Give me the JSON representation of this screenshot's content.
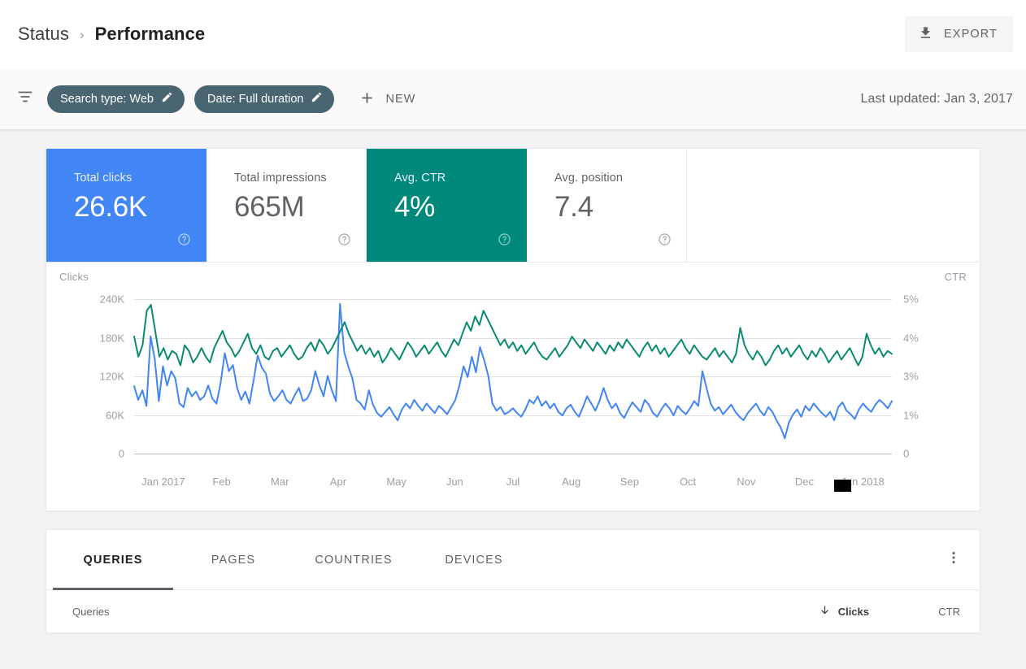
{
  "header": {
    "breadcrumb_root": "Status",
    "breadcrumb_separator": "›",
    "breadcrumb_current": "Performance",
    "export_label": "EXPORT",
    "export_icon": "download-icon"
  },
  "filter_bar": {
    "filter_icon": "tune-icon",
    "chips": [
      {
        "label": "Search type: Web",
        "icon": "pencil-icon"
      },
      {
        "label": "Date: Full duration",
        "icon": "pencil-icon"
      }
    ],
    "new_label": "NEW",
    "new_icon": "plus-icon",
    "last_updated": "Last updated: Jan 3, 2017"
  },
  "metrics": [
    {
      "label": "Total clicks",
      "value": "26.6K",
      "selected": true,
      "color": "#4285F4",
      "help_icon": "help-icon"
    },
    {
      "label": "Total impressions",
      "value": "665M",
      "selected": false,
      "color": "#FFFFFF",
      "help_icon": "help-icon"
    },
    {
      "label": "Avg. CTR",
      "value": "4%",
      "selected": true,
      "color": "#00897B",
      "help_icon": "help-icon"
    },
    {
      "label": "Avg. position",
      "value": "7.4",
      "selected": false,
      "color": "#FFFFFF",
      "help_icon": "help-icon"
    }
  ],
  "table": {
    "tabs": [
      {
        "label": "QUERIES",
        "active": true
      },
      {
        "label": "PAGES",
        "active": false
      },
      {
        "label": "COUNTRIES",
        "active": false
      },
      {
        "label": "DEVICES",
        "active": false
      }
    ],
    "more_icon": "more-vert-icon",
    "columns": {
      "first": "Queries",
      "clicks": "Clicks",
      "clicks_sort_icon": "sort-down-arrow-icon",
      "ctr": "CTR"
    }
  },
  "chart_data": {
    "type": "line",
    "title": "",
    "xlabel": "",
    "ylabel": "Clicks",
    "y2label": "CTR",
    "grid": true,
    "legend": "none",
    "left_axis": {
      "label": "Clicks",
      "ticks": [
        "240K",
        "180K",
        "120K",
        "60K",
        "0"
      ],
      "tick_values": [
        240000,
        180000,
        120000,
        60000,
        0
      ],
      "ylim": [
        0,
        240000
      ]
    },
    "right_axis": {
      "label": "CTR",
      "ticks": [
        "5%",
        "4%",
        "3%",
        "1%",
        "0"
      ],
      "tick_values": [
        5,
        4,
        3,
        1,
        0
      ],
      "ylim": [
        0,
        5
      ]
    },
    "x_ticks": [
      "Jan 2017",
      "Feb",
      "Mar",
      "Apr",
      "May",
      "Jun",
      "Jul",
      "Aug",
      "Sep",
      "Oct",
      "Nov",
      "Dec",
      "Jan 2018"
    ],
    "cursor_marker": {
      "near_tick": "Dec",
      "shape": "black-rectangle"
    },
    "series": [
      {
        "name": "Clicks",
        "color": "#4285F4",
        "axis": "left",
        "unit": "clicks",
        "values": [
          95000,
          72000,
          88000,
          62000,
          178000,
          140000,
          70000,
          128000,
          96000,
          120000,
          108000,
          66000,
          60000,
          92000,
          78000,
          86000,
          72000,
          78000,
          96000,
          74000,
          66000,
          100000,
          150000,
          120000,
          130000,
          92000,
          72000,
          86000,
          66000,
          104000,
          146000,
          126000,
          116000,
          82000,
          70000,
          78000,
          88000,
          72000,
          66000,
          80000,
          92000,
          70000,
          74000,
          88000,
          120000,
          96000,
          78000,
          112000,
          88000,
          70000,
          232000,
          152000,
          128000,
          108000,
          72000,
          66000,
          56000,
          88000,
          64000,
          50000,
          44000,
          52000,
          60000,
          48000,
          38000,
          56000,
          66000,
          58000,
          72000,
          62000,
          54000,
          66000,
          58000,
          50000,
          62000,
          56000,
          48000,
          60000,
          72000,
          96000,
          128000,
          110000,
          144000,
          118000,
          160000,
          138000,
          112000,
          66000,
          54000,
          60000,
          48000,
          52000,
          58000,
          50000,
          44000,
          56000,
          72000,
          66000,
          78000,
          62000,
          70000,
          58000,
          66000,
          52000,
          46000,
          58000,
          64000,
          52000,
          44000,
          60000,
          78000,
          66000,
          54000,
          70000,
          92000,
          72000,
          58000,
          66000,
          50000,
          42000,
          56000,
          68000,
          60000,
          52000,
          72000,
          64000,
          50000,
          44000,
          56000,
          66000,
          58000,
          46000,
          62000,
          54000,
          48000,
          58000,
          70000,
          62000,
          120000,
          92000,
          66000,
          54000,
          60000,
          48000,
          56000,
          64000,
          52000,
          44000,
          38000,
          50000,
          58000,
          66000,
          54000,
          46000,
          60000,
          52000,
          38000,
          26000,
          8000,
          34000,
          48000,
          56000,
          44000,
          62000,
          54000,
          66000,
          58000,
          50000,
          44000,
          52000,
          38000,
          60000,
          68000,
          54000,
          48000,
          40000,
          56000,
          66000,
          58000,
          52000,
          64000,
          72000,
          66000,
          58000,
          70000
        ]
      },
      {
        "name": "CTR",
        "color": "#0B8A72",
        "axis": "right",
        "unit": "percent",
        "values": [
          3.7,
          3.0,
          3.4,
          4.6,
          4.8,
          3.9,
          3.0,
          3.3,
          2.9,
          3.2,
          3.1,
          2.7,
          3.4,
          3.2,
          2.8,
          3.0,
          3.3,
          3.0,
          2.8,
          3.3,
          3.6,
          3.9,
          3.5,
          3.3,
          3.0,
          3.2,
          3.5,
          3.8,
          3.3,
          3.1,
          3.4,
          3.0,
          2.9,
          3.2,
          3.3,
          3.0,
          3.2,
          3.4,
          3.1,
          2.9,
          3.0,
          3.3,
          3.5,
          3.2,
          3.6,
          3.4,
          3.1,
          3.3,
          3.6,
          3.9,
          4.2,
          3.8,
          3.5,
          3.2,
          3.4,
          3.1,
          3.3,
          3.0,
          3.2,
          2.8,
          3.0,
          3.3,
          3.1,
          2.9,
          3.2,
          3.5,
          3.3,
          3.0,
          3.2,
          3.4,
          3.1,
          3.3,
          3.5,
          3.2,
          3.0,
          3.3,
          3.6,
          3.4,
          3.8,
          4.2,
          3.9,
          4.4,
          4.1,
          4.6,
          4.3,
          4.0,
          3.7,
          3.4,
          3.6,
          3.3,
          3.5,
          3.2,
          3.4,
          3.1,
          3.3,
          3.5,
          3.2,
          3.0,
          2.9,
          3.1,
          3.3,
          3.0,
          3.2,
          3.4,
          3.7,
          3.5,
          3.3,
          3.6,
          3.4,
          3.2,
          3.5,
          3.3,
          3.1,
          3.4,
          3.2,
          3.5,
          3.3,
          3.6,
          3.4,
          3.2,
          3.0,
          3.3,
          3.5,
          3.2,
          3.4,
          3.1,
          3.3,
          3.0,
          3.2,
          3.4,
          3.6,
          3.3,
          3.1,
          3.4,
          3.2,
          3.0,
          2.9,
          3.1,
          3.3,
          3.0,
          3.2,
          3.0,
          2.8,
          3.1,
          4.0,
          3.4,
          3.1,
          2.9,
          3.2,
          3.0,
          2.7,
          2.9,
          3.2,
          3.4,
          3.1,
          3.3,
          3.0,
          3.2,
          3.4,
          3.1,
          2.9,
          3.2,
          3.0,
          3.3,
          3.1,
          2.8,
          3.0,
          3.2,
          2.9,
          3.1,
          3.3,
          3.0,
          2.7,
          3.0,
          3.8,
          3.4,
          3.1,
          3.3,
          3.0,
          3.2,
          3.1
        ]
      }
    ]
  }
}
